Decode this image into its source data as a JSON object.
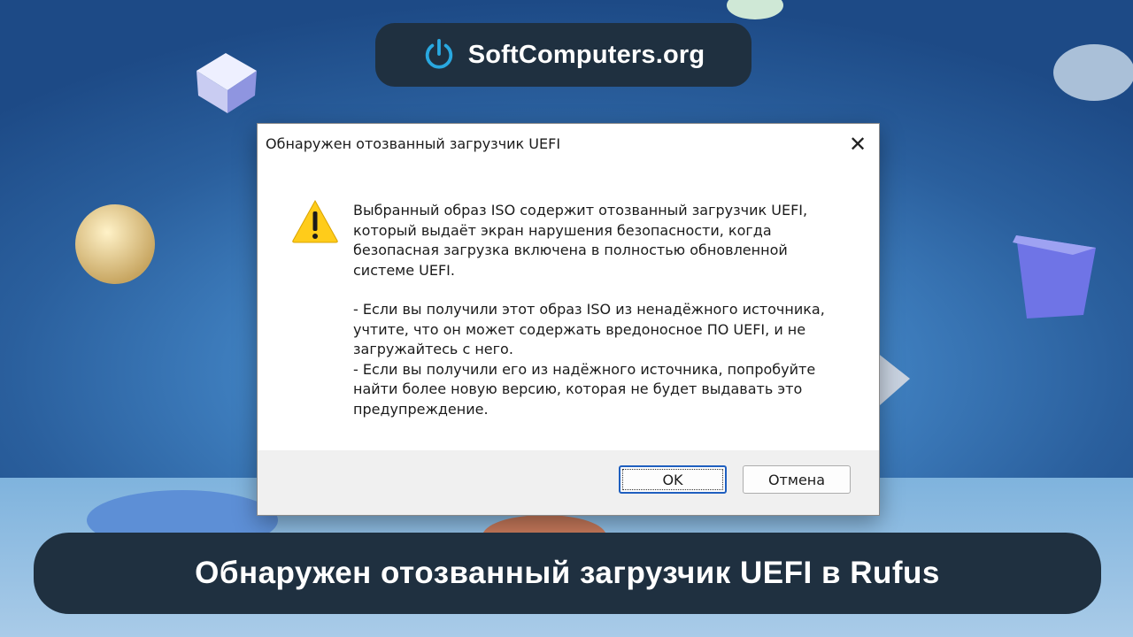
{
  "header": {
    "brand_text": "SoftComputers.org",
    "icon": "power-icon",
    "accent": "#29a8e0"
  },
  "dialog": {
    "title": "Обнаружен отозванный загрузчик UEFI",
    "close_glyph": "✕",
    "icon": "warning-icon",
    "paragraphs": [
      "Выбранный образ ISO содержит отозванный загрузчик UEFI, который выдаёт экран нарушения безопасности, когда безопасная загрузка включена в полностью обновленной системе UEFI.",
      "- Если вы получили этот образ ISO из ненадёжного источника, учтите, что он может содержать вредоносное ПО UEFI, и не загружайтесь с него.",
      "- Если вы получили его из надёжного источника, попробуйте найти более новую версию, которая не будет выдавать это предупреждение."
    ],
    "ok_label": "OK",
    "cancel_label": "Отмена"
  },
  "caption": {
    "text": "Обнаружен отозванный загрузчик UEFI в Rufus"
  }
}
